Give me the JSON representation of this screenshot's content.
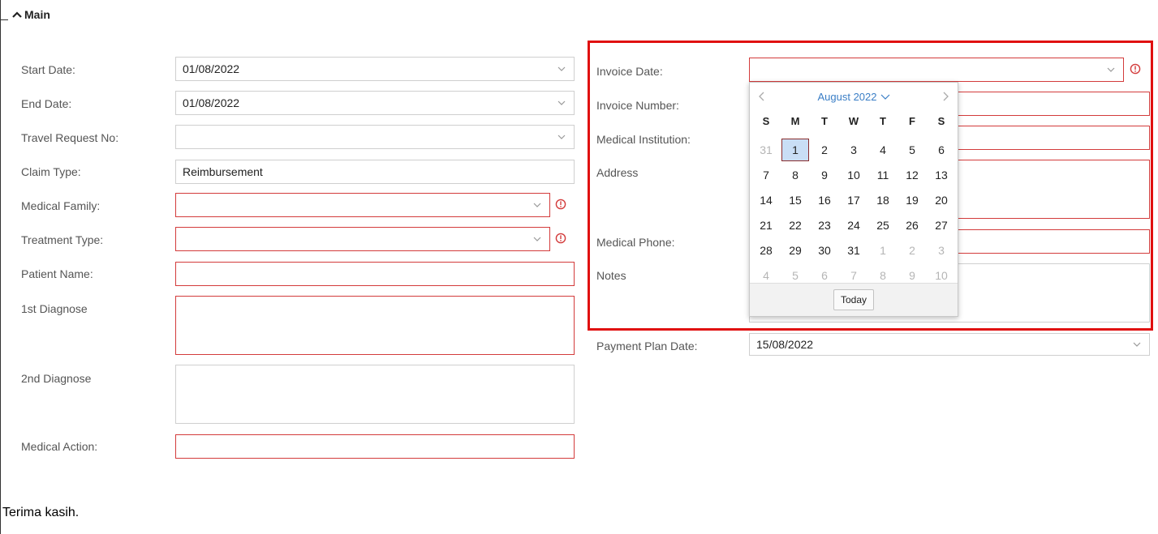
{
  "section": {
    "title": "Main"
  },
  "left": {
    "start_date": {
      "label": "Start Date:",
      "value": "01/08/2022"
    },
    "end_date": {
      "label": "End Date:",
      "value": "01/08/2022"
    },
    "travel_request": {
      "label": "Travel Request No:",
      "value": ""
    },
    "claim_type": {
      "label": "Claim Type:",
      "value": "Reimbursement"
    },
    "medical_family": {
      "label": "Medical Family:",
      "value": ""
    },
    "treatment_type": {
      "label": "Treatment Type:",
      "value": ""
    },
    "patient_name": {
      "label": "Patient Name:",
      "value": ""
    },
    "diagnose1": {
      "label": "1st Diagnose",
      "value": ""
    },
    "diagnose2": {
      "label": "2nd Diagnose",
      "value": ""
    },
    "medical_action": {
      "label": "Medical Action:",
      "value": ""
    }
  },
  "right": {
    "invoice_date": {
      "label": "Invoice Date:",
      "value": ""
    },
    "invoice_number": {
      "label": "Invoice Number:",
      "value": ""
    },
    "medical_institution": {
      "label": "Medical Institution:",
      "value": ""
    },
    "address": {
      "label": "Address",
      "value": ""
    },
    "medical_phone": {
      "label": "Medical Phone:",
      "value": ""
    },
    "notes": {
      "label": "Notes",
      "value": ""
    },
    "payment_plan_date": {
      "label": "Payment Plan Date:",
      "value": "15/08/2022"
    }
  },
  "calendar": {
    "title": "August 2022",
    "weekdays": [
      "S",
      "M",
      "T",
      "W",
      "T",
      "F",
      "S"
    ],
    "selected_day": "1",
    "weeks": [
      [
        {
          "d": "31",
          "o": true
        },
        {
          "d": "1"
        },
        {
          "d": "2"
        },
        {
          "d": "3"
        },
        {
          "d": "4"
        },
        {
          "d": "5"
        },
        {
          "d": "6"
        }
      ],
      [
        {
          "d": "7"
        },
        {
          "d": "8"
        },
        {
          "d": "9"
        },
        {
          "d": "10"
        },
        {
          "d": "11"
        },
        {
          "d": "12"
        },
        {
          "d": "13"
        }
      ],
      [
        {
          "d": "14"
        },
        {
          "d": "15"
        },
        {
          "d": "16"
        },
        {
          "d": "17"
        },
        {
          "d": "18"
        },
        {
          "d": "19"
        },
        {
          "d": "20"
        }
      ],
      [
        {
          "d": "21"
        },
        {
          "d": "22"
        },
        {
          "d": "23"
        },
        {
          "d": "24"
        },
        {
          "d": "25"
        },
        {
          "d": "26"
        },
        {
          "d": "27"
        }
      ],
      [
        {
          "d": "28"
        },
        {
          "d": "29"
        },
        {
          "d": "30"
        },
        {
          "d": "31"
        },
        {
          "d": "1",
          "o": true
        },
        {
          "d": "2",
          "o": true
        },
        {
          "d": "3",
          "o": true
        }
      ],
      [
        {
          "d": "4",
          "o": true
        },
        {
          "d": "5",
          "o": true
        },
        {
          "d": "6",
          "o": true
        },
        {
          "d": "7",
          "o": true
        },
        {
          "d": "8",
          "o": true
        },
        {
          "d": "9",
          "o": true
        },
        {
          "d": "10",
          "o": true
        }
      ]
    ],
    "today_label": "Today"
  },
  "footer": {
    "note": "Terima kasih."
  },
  "colors": {
    "required_border": "#d33b3b",
    "highlight": "#e01010",
    "calendar_accent": "#3a7ec6",
    "selected_bg": "#c9def5"
  }
}
